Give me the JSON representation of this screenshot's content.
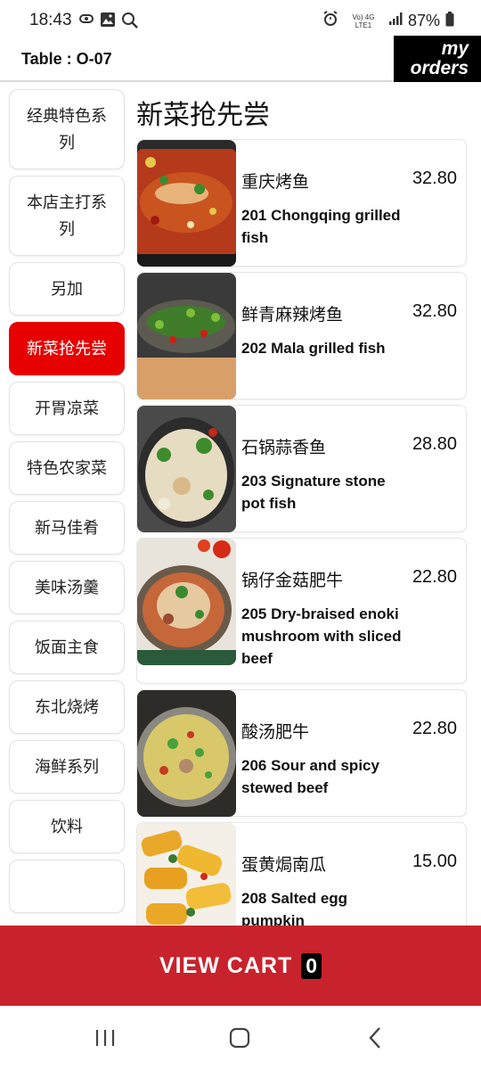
{
  "status_bar": {
    "time": "18:43",
    "network": "Vo) 4G LTE1",
    "battery": "87%",
    "icons": [
      "screen-cast-icon",
      "gallery-icon",
      "search-icon",
      "alarm-icon",
      "signal-icon",
      "battery-icon"
    ]
  },
  "header": {
    "table": "Table : O-07",
    "my_orders_line1": "my",
    "my_orders_line2": "orders"
  },
  "sidebar": {
    "categories": [
      {
        "label": "经典特色系列",
        "active": false
      },
      {
        "label": "本店主打系列",
        "active": false
      },
      {
        "label": "另加",
        "active": false
      },
      {
        "label": "新菜抢先尝",
        "active": true
      },
      {
        "label": "开胃凉菜",
        "active": false
      },
      {
        "label": "特色农家菜",
        "active": false
      },
      {
        "label": "新马佳肴",
        "active": false
      },
      {
        "label": "美味汤羹",
        "active": false
      },
      {
        "label": "饭面主食",
        "active": false
      },
      {
        "label": "东北烧烤",
        "active": false
      },
      {
        "label": "海鲜系列",
        "active": false
      },
      {
        "label": "饮料",
        "active": false
      }
    ]
  },
  "section_title": "新菜抢先尝",
  "dishes": [
    {
      "name_zh": "重庆烤鱼",
      "name_en": "201 Chongqing grilled fish",
      "price": "32.80",
      "image": "grilled-fish-photo"
    },
    {
      "name_zh": "鲜青麻辣烤鱼",
      "name_en": "202 Mala grilled fish",
      "price": "32.80",
      "image": "green-pepper-fish-photo"
    },
    {
      "name_zh": "石锅蒜香鱼",
      "name_en": "203 Signature stone pot fish",
      "price": "28.80",
      "image": "stone-pot-fish-photo"
    },
    {
      "name_zh": "锅仔金菇肥牛",
      "name_en": "205 Dry-braised enoki mushroom with sliced beef",
      "price": "22.80",
      "image": "enoki-beef-photo"
    },
    {
      "name_zh": "酸汤肥牛",
      "name_en": "206 Sour and spicy stewed beef",
      "price": "22.80",
      "image": "sour-beef-soup-photo"
    },
    {
      "name_zh": "蛋黄焗南瓜",
      "name_en": "208 Salted egg pumpkin",
      "price": "15.00",
      "image": "salted-egg-pumpkin-photo"
    }
  ],
  "cart": {
    "label": "VIEW CART",
    "count": "0"
  },
  "colors": {
    "active_category": "#e60000",
    "cart_bar": "#c8232c",
    "header_badge": "#000000"
  }
}
